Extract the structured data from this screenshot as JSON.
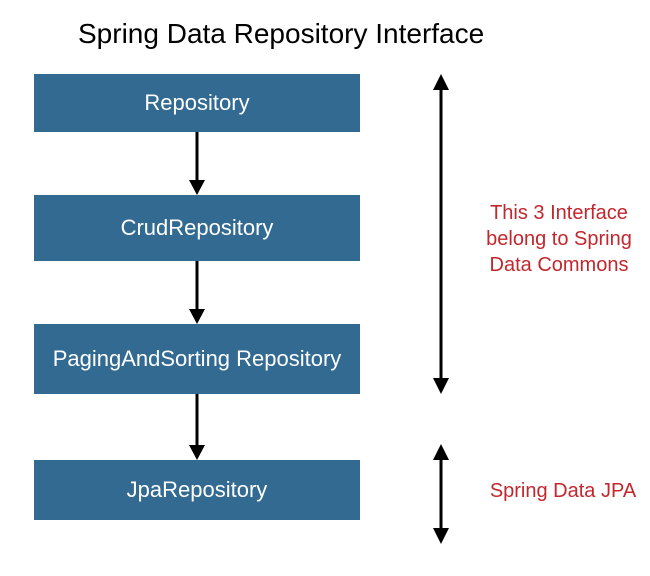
{
  "title": "Spring Data Repository Interface",
  "boxes": {
    "b1": "Repository",
    "b2": "CrudRepository",
    "b3": "PagingAndSorting Repository",
    "b4": "JpaRepository"
  },
  "notes": {
    "n1": "This 3 Interface belong to Spring Data Commons",
    "n2": "Spring Data JPA"
  },
  "colors": {
    "box_bg": "#336a92",
    "note_color": "#c1272d"
  }
}
